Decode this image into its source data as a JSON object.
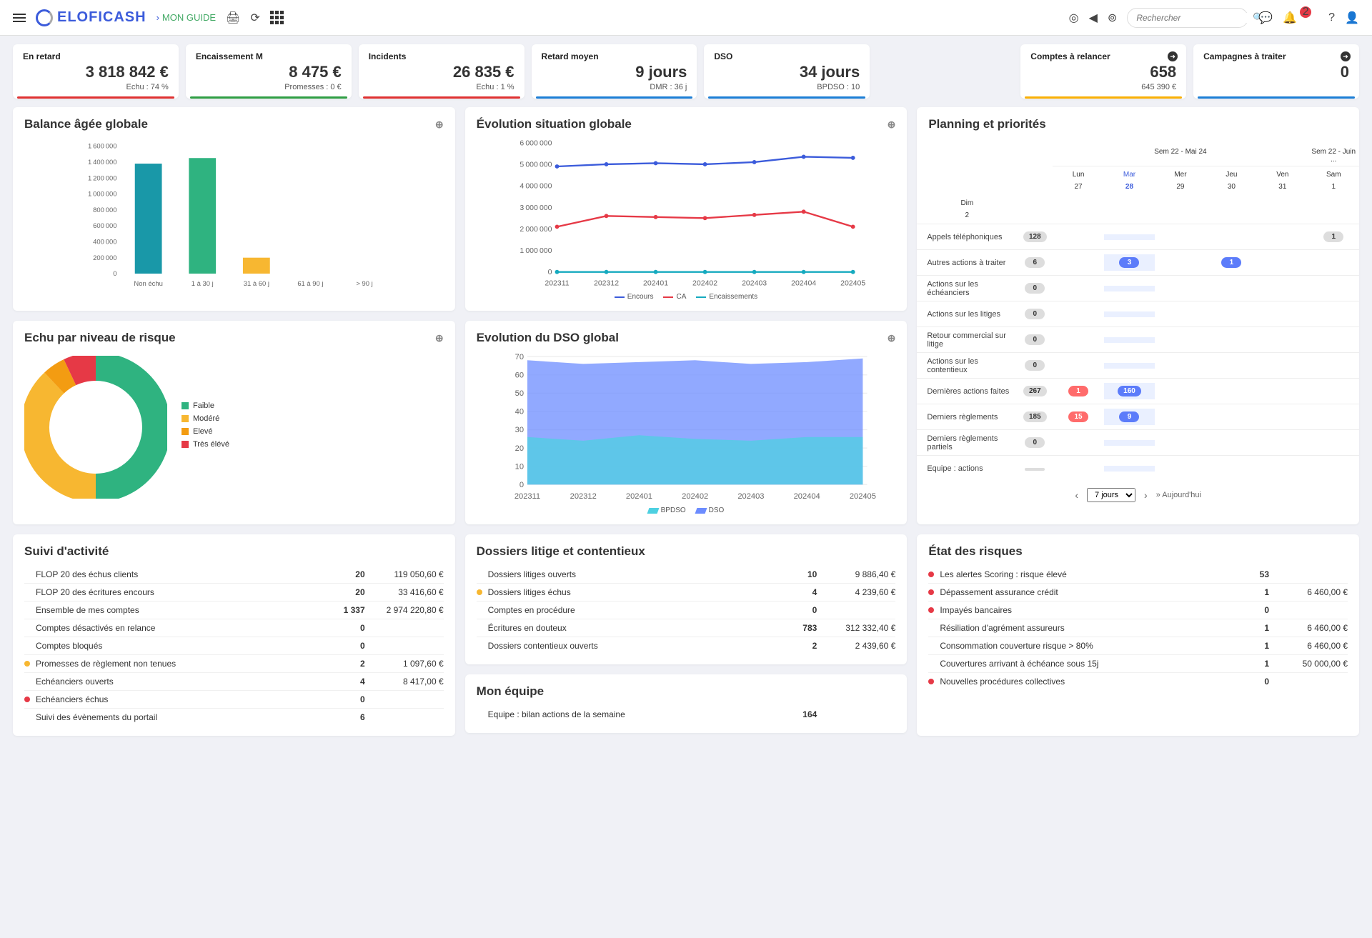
{
  "header": {
    "logo": "ELOFICASH",
    "breadcrumb": "MON GUIDE",
    "search_placeholder": "Rechercher",
    "notif_count": "2"
  },
  "kpis": [
    {
      "label": "En retard",
      "value": "3 818 842 €",
      "sub": "Echu : 74 %",
      "color": "#e03131"
    },
    {
      "label": "Encaissement M",
      "value": "8 475 €",
      "sub": "Promesses : 0 €",
      "color": "#2f9e44"
    },
    {
      "label": "Incidents",
      "value": "26 835 €",
      "sub": "Echu : 1 %",
      "color": "#e03131"
    },
    {
      "label": "Retard moyen",
      "value": "9 jours",
      "sub": "DMR : 36 j",
      "color": "#1c7ed6"
    },
    {
      "label": "DSO",
      "value": "34 jours",
      "sub": "BPDSO : 10",
      "color": "#1c7ed6"
    }
  ],
  "kpis_right": [
    {
      "label": "Comptes à relancer",
      "value": "658",
      "sub": "645 390 €",
      "color": "#fab005"
    },
    {
      "label": "Campagnes à traiter",
      "value": "0",
      "sub": "",
      "color": "#1c7ed6"
    }
  ],
  "balance": {
    "title": "Balance âgée globale",
    "chart_data": {
      "type": "bar",
      "categories": [
        "Non échu",
        "1 à 30 j",
        "31 à 60 j",
        "61 à 90 j",
        "> 90 j"
      ],
      "values": [
        1380000,
        1450000,
        200000,
        0,
        0
      ],
      "ylim": [
        0,
        1600000
      ],
      "yticks": [
        0,
        200000,
        400000,
        600000,
        800000,
        1000000,
        1200000,
        1400000,
        1600000
      ],
      "colors": [
        "#1998a8",
        "#2fb380",
        "#f7b731",
        "#f39c12",
        "#e74c3c"
      ]
    }
  },
  "evolution": {
    "title": "Évolution situation globale",
    "chart_data": {
      "type": "line",
      "x": [
        "202311",
        "202312",
        "202401",
        "202402",
        "202403",
        "202404",
        "202405"
      ],
      "series": [
        {
          "name": "Encours",
          "color": "#3b5bdb",
          "values": [
            4900000,
            5000000,
            5050000,
            5000000,
            5100000,
            5350000,
            5300000
          ]
        },
        {
          "name": "CA",
          "color": "#e63946",
          "values": [
            2100000,
            2600000,
            2550000,
            2500000,
            2650000,
            2800000,
            2100000
          ]
        },
        {
          "name": "Encaissements",
          "color": "#15aabf",
          "values": [
            0,
            0,
            0,
            0,
            0,
            0,
            0
          ]
        }
      ],
      "ylim": [
        0,
        6000000
      ],
      "yticks": [
        0,
        1000000,
        2000000,
        3000000,
        4000000,
        5000000,
        6000000
      ]
    }
  },
  "risque": {
    "title": "Echu par niveau de risque",
    "chart_data": {
      "type": "pie",
      "slices": [
        {
          "name": "Faible",
          "value": 50,
          "color": "#2fb380"
        },
        {
          "name": "Modéré",
          "value": 38,
          "color": "#f7b731"
        },
        {
          "name": "Elevé",
          "value": 5,
          "color": "#f39c12"
        },
        {
          "name": "Très élévé",
          "value": 7,
          "color": "#e63946"
        }
      ]
    }
  },
  "dso": {
    "title": "Evolution du DSO global",
    "chart_data": {
      "type": "area",
      "x": [
        "202311",
        "202312",
        "202401",
        "202402",
        "202403",
        "202404",
        "202405"
      ],
      "series": [
        {
          "name": "BPDSO",
          "color": "#4dd0e1",
          "values": [
            26,
            24,
            27,
            25,
            24,
            26,
            26
          ]
        },
        {
          "name": "DSO",
          "color": "#6c8cff",
          "values": [
            68,
            66,
            67,
            68,
            66,
            67,
            69
          ]
        }
      ],
      "ylim": [
        0,
        70
      ],
      "yticks": [
        0,
        10,
        20,
        30,
        40,
        50,
        60,
        70
      ]
    }
  },
  "planning": {
    "title": "Planning et priorités",
    "week1": "Sem 22 - Mai 24",
    "week2": "Sem 22 - Juin ...",
    "days": [
      {
        "d": "Lun",
        "n": "27"
      },
      {
        "d": "Mar",
        "n": "28",
        "active": true
      },
      {
        "d": "Mer",
        "n": "29"
      },
      {
        "d": "Jeu",
        "n": "30"
      },
      {
        "d": "Ven",
        "n": "31"
      },
      {
        "d": "Sam",
        "n": "1"
      },
      {
        "d": "Dim",
        "n": "2"
      }
    ],
    "rows": [
      {
        "label": "Appels téléphoniques",
        "total": "128",
        "cells": [
          "",
          "",
          "",
          "",
          "",
          "1"
        ]
      },
      {
        "label": "Autres actions à traiter",
        "total": "6",
        "cells": [
          "",
          "3",
          "",
          "1",
          "",
          ""
        ],
        "style": "blue"
      },
      {
        "label": "Actions sur les échéanciers",
        "total": "0",
        "cells": [
          "",
          "",
          "",
          "",
          "",
          ""
        ]
      },
      {
        "label": "Actions sur les litiges",
        "total": "0",
        "cells": [
          "",
          "",
          "",
          "",
          "",
          ""
        ]
      },
      {
        "label": "Retour commercial sur litige",
        "total": "0",
        "cells": [
          "",
          "",
          "",
          "",
          "",
          ""
        ]
      },
      {
        "label": "Actions sur les contentieux",
        "total": "0",
        "cells": [
          "",
          "",
          "",
          "",
          "",
          ""
        ]
      },
      {
        "label": "Dernières actions faites",
        "total": "267",
        "cells": [
          "1r",
          "160b",
          "",
          "",
          "",
          ""
        ]
      },
      {
        "label": "Derniers règlements",
        "total": "185",
        "cells": [
          "15r",
          "9b",
          "",
          "",
          "",
          ""
        ]
      },
      {
        "label": "Derniers règlements partiels",
        "total": "0",
        "cells": [
          "",
          "",
          "",
          "",
          "",
          ""
        ]
      },
      {
        "label": "Equipe : actions",
        "total": "",
        "cells": [
          "",
          "",
          "",
          "",
          "",
          ""
        ]
      }
    ],
    "range": "7 jours",
    "today": "» Aujourd'hui"
  },
  "activite": {
    "title": "Suivi d'activité",
    "rows": [
      {
        "name": "FLOP 20 des échus clients",
        "n1": "20",
        "n2": "119 050,60 €"
      },
      {
        "name": "FLOP 20 des écritures encours",
        "n1": "20",
        "n2": "33 416,60 €"
      },
      {
        "name": "Ensemble de mes comptes",
        "n1": "1 337",
        "n2": "2 974 220,80 €"
      },
      {
        "name": "Comptes désactivés en relance",
        "n1": "0",
        "n2": ""
      },
      {
        "name": "Comptes bloqués",
        "n1": "0",
        "n2": ""
      },
      {
        "name": "Promesses de règlement non tenues",
        "n1": "2",
        "n2": "1 097,60 €",
        "dot": "#f7b731"
      },
      {
        "name": "Echéanciers ouverts",
        "n1": "4",
        "n2": "8 417,00 €"
      },
      {
        "name": "Echéanciers échus",
        "n1": "0",
        "n2": "",
        "dot": "#e63946"
      },
      {
        "name": "Suivi des évènements du portail",
        "n1": "6",
        "n2": ""
      }
    ]
  },
  "litige": {
    "title": "Dossiers litige et contentieux",
    "rows": [
      {
        "name": "Dossiers litiges ouverts",
        "n1": "10",
        "n2": "9 886,40 €"
      },
      {
        "name": "Dossiers litiges échus",
        "n1": "4",
        "n2": "4 239,60 €",
        "dot": "#f7b731"
      },
      {
        "name": "Comptes en procédure",
        "n1": "0",
        "n2": ""
      },
      {
        "name": "Écritures en douteux",
        "n1": "783",
        "n2": "312 332,40 €"
      },
      {
        "name": "Dossiers contentieux ouverts",
        "n1": "2",
        "n2": "2 439,60 €"
      }
    ]
  },
  "equipe": {
    "title": "Mon équipe",
    "rows": [
      {
        "name": "Equipe : bilan actions de la semaine",
        "n1": "164",
        "n2": ""
      }
    ]
  },
  "risques": {
    "title": "État des risques",
    "rows": [
      {
        "name": "Les alertes Scoring : risque élevé",
        "n1": "53",
        "n2": "",
        "dot": "#e63946"
      },
      {
        "name": "Dépassement assurance crédit",
        "n1": "1",
        "n2": "6 460,00 €",
        "dot": "#e63946"
      },
      {
        "name": "Impayés bancaires",
        "n1": "0",
        "n2": "",
        "dot": "#e63946"
      },
      {
        "name": "Résiliation d'agrément assureurs",
        "n1": "1",
        "n2": "6 460,00 €"
      },
      {
        "name": "Consommation couverture risque > 80%",
        "n1": "1",
        "n2": "6 460,00 €"
      },
      {
        "name": "Couvertures arrivant à échéance sous 15j",
        "n1": "1",
        "n2": "50 000,00 €"
      },
      {
        "name": "Nouvelles procédures collectives",
        "n1": "0",
        "n2": "",
        "dot": "#e63946"
      }
    ]
  },
  "chart_data": [
    {
      "ref": "balance"
    },
    {
      "ref": "evolution"
    },
    {
      "ref": "risque"
    },
    {
      "ref": "dso"
    }
  ]
}
